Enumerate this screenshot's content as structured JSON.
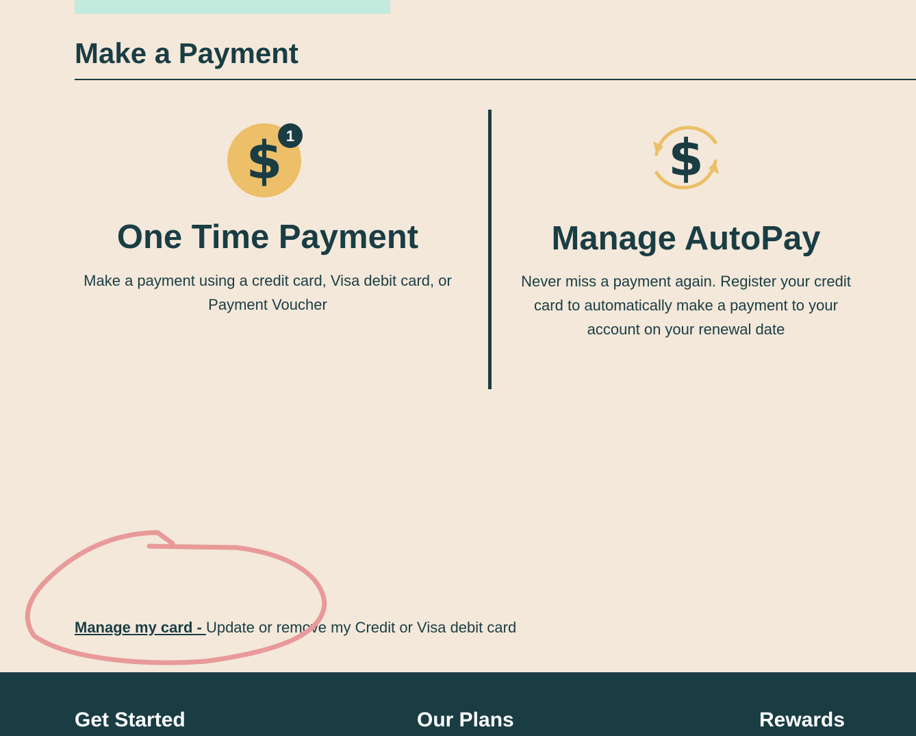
{
  "header": {
    "title": "Make a Payment"
  },
  "options": [
    {
      "heading": "One Time Payment",
      "description": "Make a payment using a credit card, Visa debit card, or Payment Voucher",
      "icon": "dollar-coin-icon",
      "badge": "1"
    },
    {
      "heading": "Manage AutoPay",
      "description": "Never miss a payment again. Register your credit card to automatically make a payment to your account on your renewal date",
      "icon": "dollar-refresh-icon"
    }
  ],
  "manage_card": {
    "link_label": "Manage my card - ",
    "description": "Update or remove my Credit or Visa debit card"
  },
  "footer": {
    "links": [
      "Get Started",
      "Our Plans",
      "Rewards"
    ]
  },
  "colors": {
    "background": "#f3e8da",
    "text": "#1a3d44",
    "accent_gold": "#ecbf68",
    "banner_mint": "#c2eadd",
    "footer": "#1a3d44",
    "annotation": "#e89a9a"
  }
}
